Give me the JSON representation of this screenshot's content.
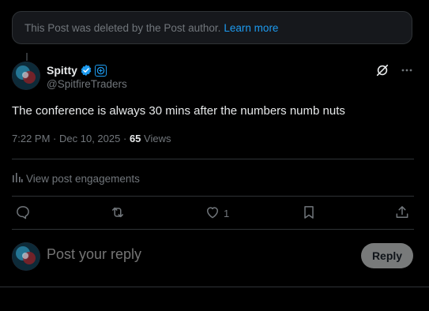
{
  "notice": {
    "text": "This Post was deleted by the Post author.",
    "link": "Learn more"
  },
  "post": {
    "author_name": "Spitty",
    "author_handle": "@SpitfireTraders",
    "verified_icon": "verified-badge-icon",
    "affiliate_icon": "affiliate-badge-icon",
    "text": "The conference is always 30 mins after the numbers numb nuts",
    "time": "7:22 PM",
    "separator": "·",
    "date": "Dec 10, 2025",
    "views_count": "65",
    "views_label": "Views",
    "engagements_label": "View post engagements"
  },
  "actions": {
    "reply_icon": "reply-icon",
    "repost_icon": "repost-icon",
    "like_icon": "like-icon",
    "like_count": "1",
    "bookmark_icon": "bookmark-icon",
    "share_icon": "share-icon"
  },
  "composer": {
    "placeholder": "Post your reply",
    "button_label": "Reply"
  },
  "colors": {
    "background": "#000000",
    "accent": "#1d9bf0",
    "text": "#e7e9ea",
    "muted": "#71767b",
    "border": "#2f3336"
  }
}
